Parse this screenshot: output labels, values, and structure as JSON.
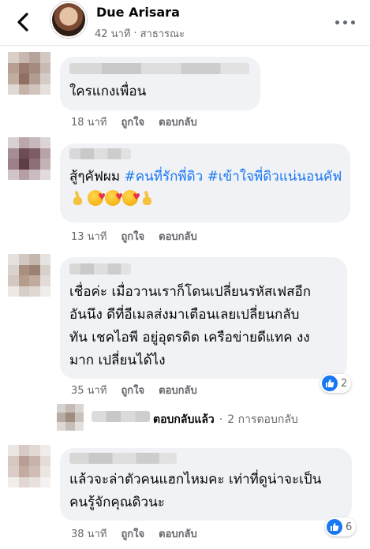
{
  "header": {
    "name": "Due Arisara",
    "time": "42 นาที",
    "dot": "·",
    "audience": "สาธารณะ"
  },
  "comments": [
    {
      "text": "ใครแกงเพื่อน",
      "time": "18 นาที",
      "like_label": "ถูกใจ",
      "reply_label": "ตอบกลับ"
    },
    {
      "text_prefix": "สู้ๆคัฟผม ",
      "tags": [
        "#คนที่รักพี่ดิว",
        "#เข้าใจพี่ดิวแน่นอนคัฟ"
      ],
      "emojis": [
        "victory-hand-emoji",
        "smiling-face-with-hearts-emoji",
        "smiling-face-with-hearts-emoji",
        "smiling-face-with-hearts-emoji",
        "victory-hand-emoji"
      ],
      "time": "13 นาที",
      "like_label": "ถูกใจ",
      "reply_label": "ตอบกลับ"
    },
    {
      "text": "เชื่อค่ะ เมื่อวานเราก็โดนเปลี่ยนรหัสเฟสอีก\nอันนึง ดีที่อีเมลส่งมาเตือนเลยเปลี่ยนกลับ\nทัน เชคไอพี อยู่อุตรดิต เครือข่ายดีแทค งง\nมาก เปลี่ยนได้ไง",
      "time": "35 นาที",
      "like_label": "ถูกใจ",
      "reply_label": "ตอบกลับ",
      "reaction_count": "2",
      "reply_summary": {
        "replied": "ตอบกลับแล้ว",
        "dot": "·",
        "count": "2 การตอบกลับ"
      }
    },
    {
      "text": "แล้วจะล่าตัวคนแฮกไหมคะ เท่าที่ดูน่าจะเป็น\nคนรู้จักคุณดิวนะ",
      "time": "38 นาที",
      "like_label": "ถูกใจ",
      "reply_label": "ตอบกลับ",
      "reaction_count": "6"
    }
  ],
  "colors": {
    "accent": "#1877f2",
    "bubble": "#f0f2f5",
    "muted": "#65676b"
  }
}
